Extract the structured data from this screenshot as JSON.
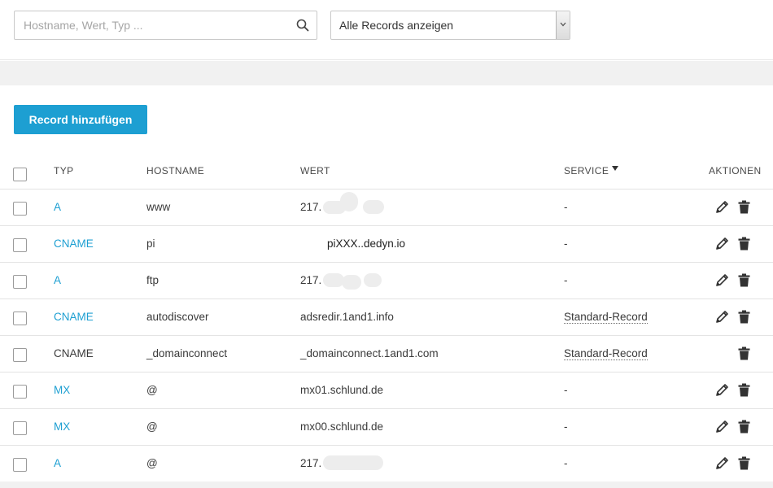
{
  "search": {
    "placeholder": "Hostname, Wert, Typ ..."
  },
  "filter": {
    "selected": "Alle Records anzeigen"
  },
  "add_button_label": "Record hinzufügen",
  "columns": {
    "typ": "TYP",
    "hostname": "HOSTNAME",
    "wert": "WERT",
    "service": "SERVICE",
    "aktionen": "AKTIONEN"
  },
  "rows": [
    {
      "typ": "A",
      "hostname": "www",
      "wert": "217.",
      "service": "-",
      "editable": true,
      "typ_link": true
    },
    {
      "typ": "CNAME",
      "hostname": "pi",
      "wert": "piXXX..dedyn.io",
      "service": "-",
      "editable": true,
      "typ_link": true
    },
    {
      "typ": "A",
      "hostname": "ftp",
      "wert": "217.",
      "service": "-",
      "editable": true,
      "typ_link": true
    },
    {
      "typ": "CNAME",
      "hostname": "autodiscover",
      "wert": "adsredir.1and1.info",
      "service": "Standard-Record",
      "editable": true,
      "typ_link": true
    },
    {
      "typ": "CNAME",
      "hostname": "_domainconnect",
      "wert": "_domainconnect.1and1.com",
      "service": "Standard-Record",
      "editable": false,
      "typ_link": false
    },
    {
      "typ": "MX",
      "hostname": "@",
      "wert": "mx01.schlund.de",
      "service": "-",
      "editable": true,
      "typ_link": true
    },
    {
      "typ": "MX",
      "hostname": "@",
      "wert": "mx00.schlund.de",
      "service": "-",
      "editable": true,
      "typ_link": true
    },
    {
      "typ": "A",
      "hostname": "@",
      "wert": "217.",
      "service": "-",
      "editable": true,
      "typ_link": true
    }
  ],
  "colors": {
    "accent": "#1d9fd2",
    "band": "#f1f1f1",
    "border": "#e4e4e4"
  }
}
